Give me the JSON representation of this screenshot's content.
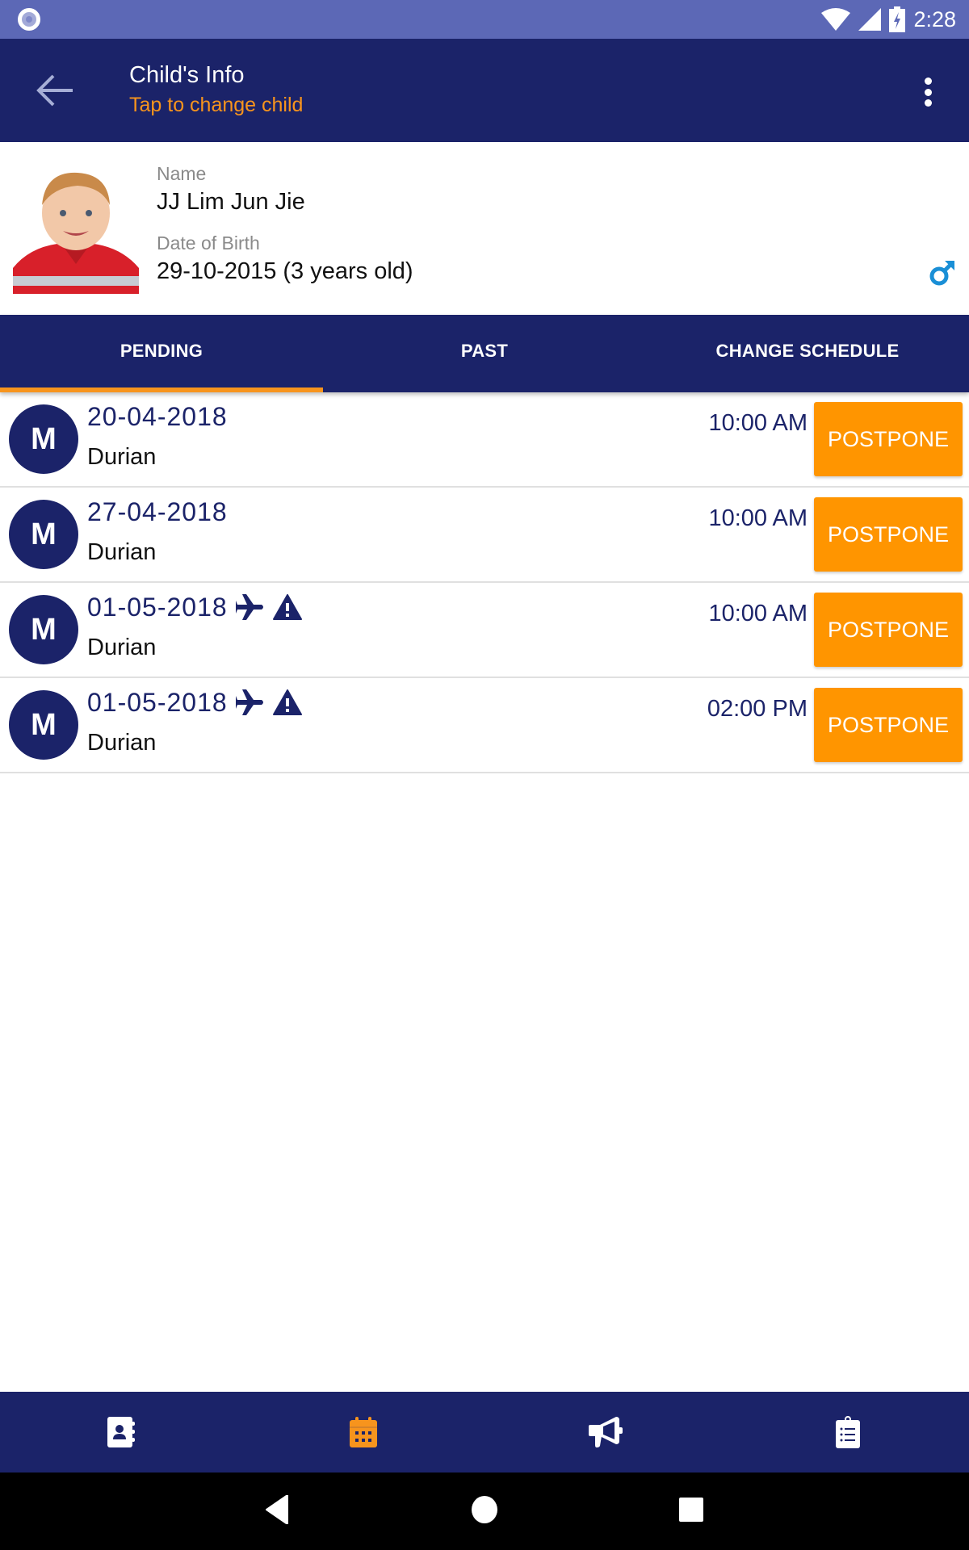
{
  "status_bar": {
    "time": "2:28",
    "icons": [
      "notification-dot-icon",
      "wifi-icon",
      "cell-signal-icon",
      "battery-charging-icon"
    ]
  },
  "app_bar": {
    "title": "Child's Info",
    "subtitle": "Tap to change child",
    "back_icon": "arrow-left-icon",
    "menu_icon": "more-vertical-icon"
  },
  "child": {
    "name_label": "Name",
    "name": "JJ Lim Jun Jie",
    "dob_label": "Date of Birth",
    "dob": "29-10-2015 (3 years old)",
    "gender_icon": "male-icon"
  },
  "tabs": [
    {
      "label": "PENDING",
      "active": true
    },
    {
      "label": "PAST",
      "active": false
    },
    {
      "label": "CHANGE SCHEDULE",
      "active": false
    }
  ],
  "appointments": [
    {
      "avatar": "M",
      "date": "20-04-2018",
      "name": "Durian",
      "time": "10:00 AM",
      "icons": [],
      "action": "POSTPONE"
    },
    {
      "avatar": "M",
      "date": "27-04-2018",
      "name": "Durian",
      "time": "10:00 AM",
      "icons": [],
      "action": "POSTPONE"
    },
    {
      "avatar": "M",
      "date": "01-05-2018",
      "name": "Durian",
      "time": "10:00 AM",
      "icons": [
        "airplane-icon",
        "warning-icon"
      ],
      "action": "POSTPONE"
    },
    {
      "avatar": "M",
      "date": "01-05-2018",
      "name": "Durian",
      "time": "02:00 PM",
      "icons": [
        "airplane-icon",
        "warning-icon"
      ],
      "action": "POSTPONE"
    }
  ],
  "bottom_nav": [
    {
      "icon": "contact-book-icon",
      "active": false
    },
    {
      "icon": "calendar-icon",
      "active": true
    },
    {
      "icon": "megaphone-icon",
      "active": false
    },
    {
      "icon": "clipboard-list-icon",
      "active": false
    }
  ],
  "colors": {
    "primary": "#1b2369",
    "accent": "#f7941d",
    "button": "#ff9500",
    "status_bar": "#5c68b6",
    "gender": "#1a8fd6"
  }
}
